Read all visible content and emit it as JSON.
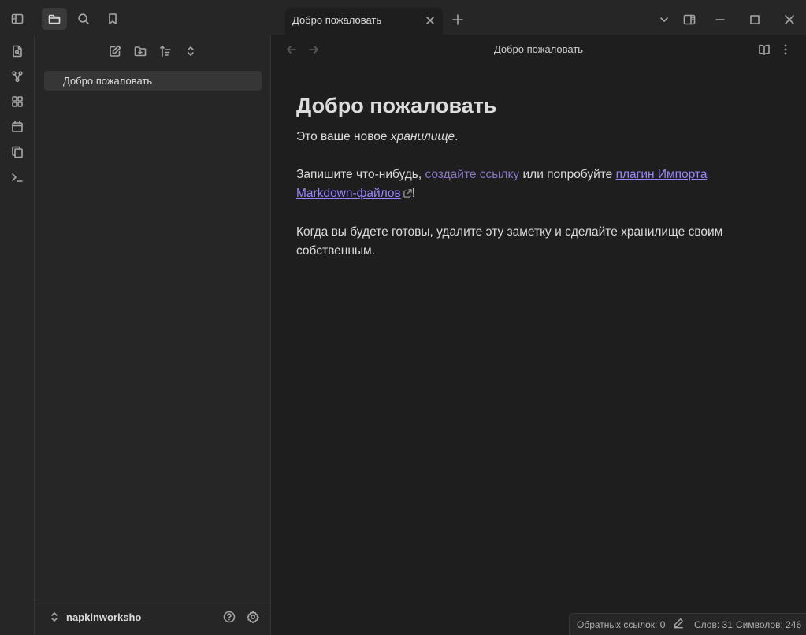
{
  "window": {
    "tab_title": "Добро пожаловать",
    "view_title": "Добро пожаловать"
  },
  "file_explorer": {
    "files": [
      {
        "label": "Добро пожаловать"
      }
    ]
  },
  "vault": {
    "name": "napkinworksho"
  },
  "note": {
    "heading": "Добро пожаловать",
    "p1_prefix": "Это ваше новое ",
    "p1_em": "хранилище",
    "p1_suffix": ".",
    "p2_prefix": "Запишите что-нибудь, ",
    "p2_internal_link": "создайте ссылку",
    "p2_middle": " или попробуйте ",
    "p2_external_link_1": "плагин Импорта ",
    "p2_external_link_2": "Markdown-файлов",
    "p2_suffix": "!",
    "p3_line1": "Когда вы будете готовы, удалите эту заметку и сделайте хранилище своим",
    "p3_line2": "собственным."
  },
  "statusbar": {
    "backlinks": "Обратных ссылок: 0",
    "words": "Слов: 31",
    "chars": "Символов: 246"
  },
  "colors": {
    "background": "#1e1e1e",
    "panel": "#262626",
    "internal_link": "#8a76c8",
    "external_link": "#9b85ff"
  }
}
